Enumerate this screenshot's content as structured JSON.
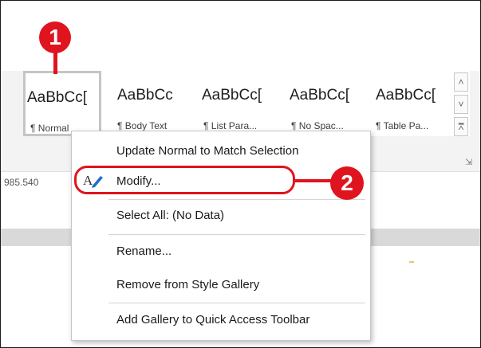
{
  "gallery": {
    "styles": [
      {
        "sample": "AaBbCc[",
        "name": "¶ Normal"
      },
      {
        "sample": "AaBbCc",
        "name": "¶ Body Text"
      },
      {
        "sample": "AaBbCc[",
        "name": "¶ List Para..."
      },
      {
        "sample": "AaBbCc[",
        "name": "¶ No Spac..."
      },
      {
        "sample": "AaBbCc[",
        "name": "¶ Table Pa..."
      }
    ]
  },
  "ruler_value": "985.540",
  "context_menu": {
    "items": [
      "Update Normal to Match Selection",
      "Modify...",
      "Select All: (No Data)",
      "Rename...",
      "Remove from Style Gallery",
      "Add Gallery to Quick Access Toolbar"
    ]
  },
  "callouts": {
    "step1": "1",
    "step2": "2"
  },
  "colors": {
    "callout_red": "#e0141e",
    "selected_border": "#c5c5c5"
  },
  "icons": [
    "scroll-up-icon",
    "scroll-down-icon",
    "gallery-more-icon",
    "dialog-launcher-icon",
    "modify-style-icon"
  ]
}
